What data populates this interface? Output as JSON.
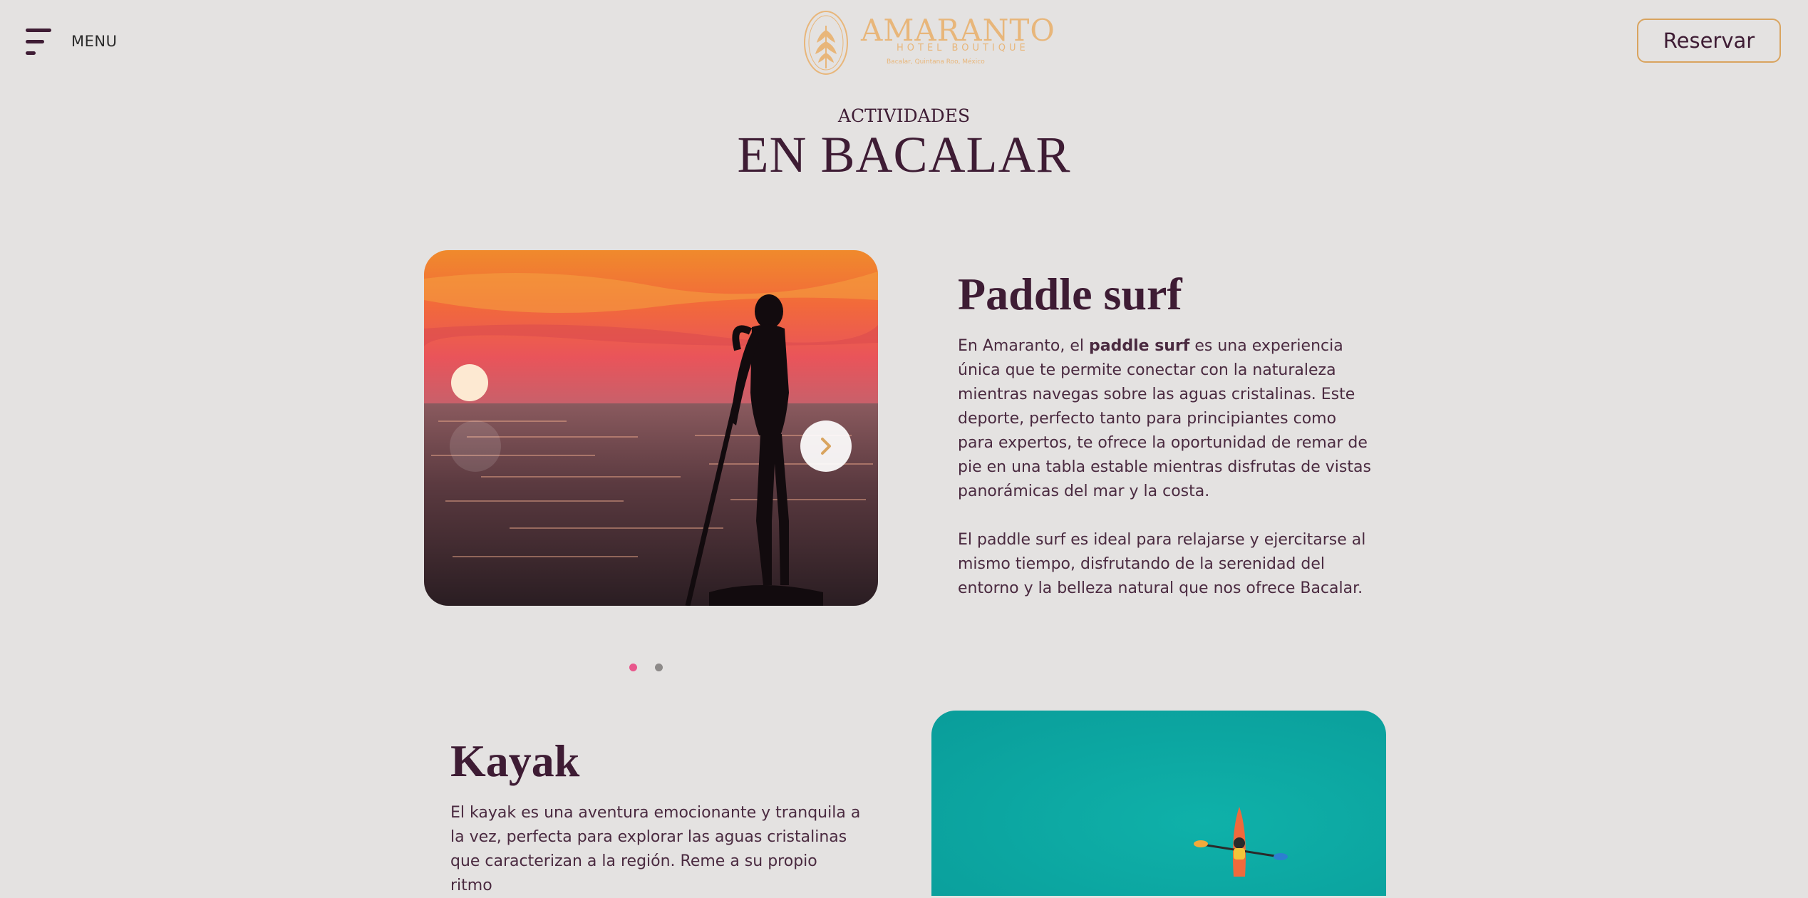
{
  "header": {
    "menu_label": "MENU",
    "reserve_label": "Reservar",
    "logo": {
      "name": "AMARANTO",
      "subtitle": "HOTEL BOUTIQUE",
      "location": "Bacalar, Quintana Roo, México"
    }
  },
  "hero": {
    "kicker": "ACTIVIDADES",
    "title": "EN BACALAR"
  },
  "activities": [
    {
      "title": "Paddle surf",
      "paragraph1_before": "En Amaranto, el ",
      "paragraph1_bold": "paddle surf",
      "paragraph1_after": " es una experiencia única que te permite conectar con la naturaleza mientras navegas sobre las aguas cristalinas. Este deporte, perfecto tanto para principiantes como para expertos, te ofrece la oportunidad de remar de pie en una tabla estable mientras disfrutas de vistas panorámicas del mar y la costa.",
      "paragraph2": "El paddle surf es ideal para relajarse y ejercitarse al mismo tiempo, disfrutando de la serenidad del entorno y la belleza natural que nos ofrece Bacalar."
    },
    {
      "title": "Kayak",
      "paragraph1": "El kayak es una aventura emocionante y tranquila a la vez, perfecta para explorar las aguas cristalinas que caracterizan a la región. Reme a su propio ritmo"
    }
  ],
  "carousel": {
    "slides_total": 2,
    "active_slide": 1,
    "active_color": "#e8578c",
    "inactive_color": "#8d8a89"
  },
  "colors": {
    "background": "#e4e2e1",
    "primary_text": "#3e1c34",
    "accent_gold": "#d9a45f"
  },
  "icons": {
    "menu": "hamburger-menu-icon",
    "next": "chevron-right-icon",
    "prev": "chevron-left-icon"
  }
}
